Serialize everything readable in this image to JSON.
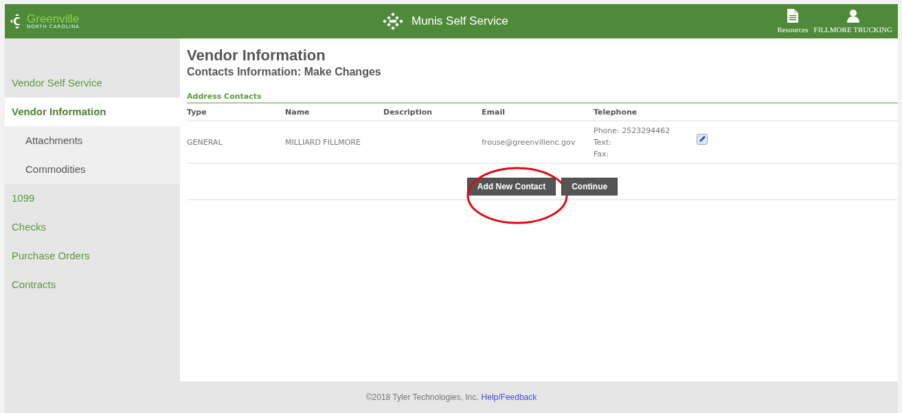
{
  "header": {
    "logo": {
      "name": "Greenville",
      "subtitle": "NORTH CAROLINA"
    },
    "title": "Munis Self Service",
    "links": [
      {
        "label": "Resources",
        "kind": "document"
      },
      {
        "label": "FILLMORE TRUCKING",
        "kind": "user"
      }
    ]
  },
  "sidebar": {
    "items": [
      {
        "label": "Vendor Self Service",
        "selected": false
      },
      {
        "label": "Vendor Information",
        "selected": true,
        "children": [
          {
            "label": "Attachments",
            "selected": false
          },
          {
            "label": "Commodities",
            "selected": false
          }
        ]
      },
      {
        "label": "1099",
        "selected": false
      },
      {
        "label": "Checks",
        "selected": false
      },
      {
        "label": "Purchase Orders",
        "selected": false
      },
      {
        "label": "Contracts",
        "selected": false
      }
    ]
  },
  "page": {
    "title": "Vendor Information",
    "subtitle": "Contacts Information: Make Changes"
  },
  "table": {
    "title": "Address Contacts",
    "columns": [
      "Type",
      "Name",
      "Description",
      "Email",
      "Telephone"
    ],
    "rows": [
      {
        "type": "GENERAL",
        "name": "MILLIARD FILLMORE",
        "email": "frouse@greenvillenc.gov",
        "telephone": [
          "Phone: 2523294462",
          "Text:",
          "Fax:"
        ]
      }
    ]
  },
  "buttons": [
    {
      "label": "Add New Contact",
      "highlighted": true
    },
    {
      "label": "Continue",
      "highlighted": false
    }
  ],
  "footer": {
    "copyright": "©2018 Tyler Technologies, Inc.",
    "link": "Help/Feedback"
  }
}
